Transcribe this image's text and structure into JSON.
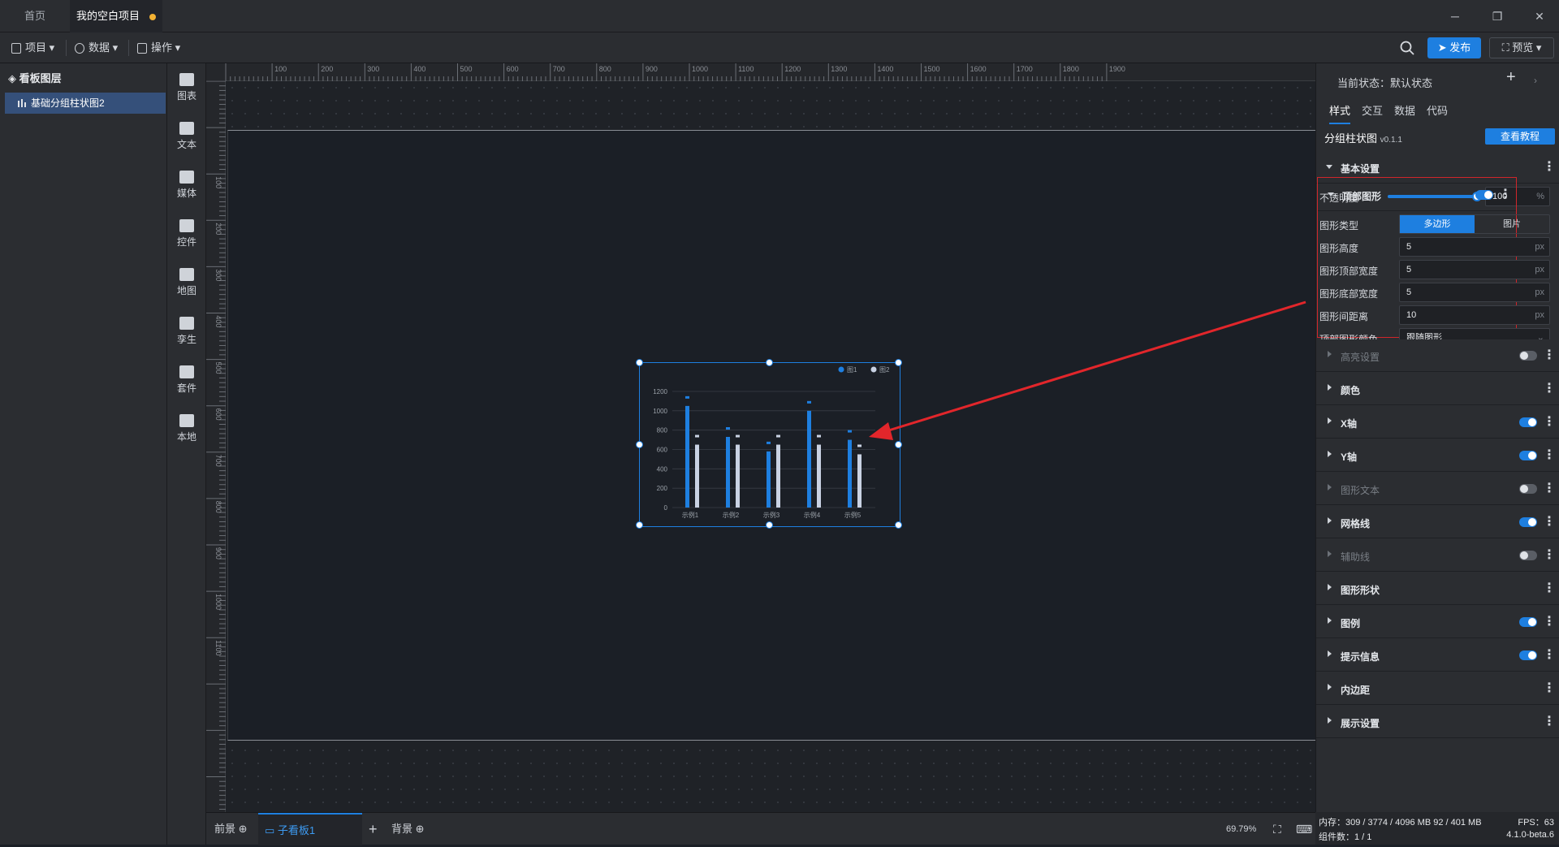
{
  "titlebar": {
    "tabs": [
      {
        "label": "首页"
      },
      {
        "label": "我的空白项目"
      }
    ],
    "win": {
      "minimize": "─",
      "restore": "❐",
      "close": "✕"
    }
  },
  "menubar": {
    "project": "项目",
    "data": "数据",
    "ops": "操作",
    "publish": "发布",
    "preview": "预览"
  },
  "layers": {
    "title": "看板图层",
    "items": [
      {
        "label": "基础分组柱状图2"
      }
    ]
  },
  "components": [
    {
      "label": "图表"
    },
    {
      "label": "文本"
    },
    {
      "label": "媒体"
    },
    {
      "label": "控件"
    },
    {
      "label": "地图"
    },
    {
      "label": "孪生"
    },
    {
      "label": "套件"
    },
    {
      "label": "本地"
    }
  ],
  "ruler": {
    "top": [
      "100",
      "200",
      "300",
      "400",
      "500",
      "600",
      "700",
      "800",
      "900",
      "1000",
      "1100",
      "1200",
      "1300",
      "1400",
      "1500",
      "1600",
      "1700",
      "1800",
      "1900"
    ],
    "left": [
      "100",
      "200",
      "300",
      "400",
      "500",
      "600",
      "700",
      "800",
      "900",
      "1000",
      "1100"
    ]
  },
  "chart_data": {
    "type": "bar",
    "categories": [
      "示例1",
      "示例2",
      "示例3",
      "示例4",
      "示例5"
    ],
    "series": [
      {
        "name": "图1",
        "values": [
          1050,
          730,
          580,
          1000,
          700
        ]
      },
      {
        "name": "图2",
        "values": [
          650,
          650,
          650,
          650,
          550
        ]
      }
    ],
    "yticks": [
      "0",
      "200",
      "400",
      "600",
      "800",
      "1000",
      "1200"
    ],
    "ylim": [
      0,
      1200
    ],
    "legend": "top-right",
    "grid": true,
    "colors": [
      "#1e7fe0",
      "#c9d2e3"
    ]
  },
  "bottom": {
    "front": "前景",
    "board": "子看板1",
    "back": "背景",
    "zoom": "69.79%"
  },
  "panel": {
    "state_label": "当前状态：默认状态",
    "tabs": [
      "样式",
      "交互",
      "数据",
      "代码"
    ],
    "comp_name": "分组柱状图",
    "version": "v0.1.1",
    "tutorial": "查看教程",
    "basic": "基本设置",
    "opacity_label": "不透明度",
    "opacity_value": "100",
    "opacity_unit": "%",
    "opacity": 1.0,
    "top_shape": {
      "title": "顶部图形",
      "type_label": "图形类型",
      "type_opts": [
        "多边形",
        "图片"
      ],
      "height_label": "图形高度",
      "height": "5",
      "topw_label": "图形顶部宽度",
      "topw": "5",
      "botw_label": "图形底部宽度",
      "botw": "5",
      "gap_label": "图形间距离",
      "gap": "10",
      "color_label": "顶部图形颜色",
      "color": "跟随图形",
      "unit": "px"
    },
    "sections": [
      {
        "label": "高亮设置",
        "toggle": "off",
        "dim": true
      },
      {
        "label": "颜色"
      },
      {
        "label": "X轴",
        "toggle": "on"
      },
      {
        "label": "Y轴",
        "toggle": "on"
      },
      {
        "label": "图形文本",
        "toggle": "off",
        "dim": true
      },
      {
        "label": "网格线",
        "toggle": "on"
      },
      {
        "label": "辅助线",
        "toggle": "off",
        "dim": true
      },
      {
        "label": "图形形状"
      },
      {
        "label": "图例",
        "toggle": "on"
      },
      {
        "label": "提示信息",
        "toggle": "on"
      },
      {
        "label": "内边距"
      },
      {
        "label": "展示设置"
      }
    ]
  },
  "status": {
    "mem": "内存：309 / 3774 / 4096 MB  92 / 401 MB",
    "fps": "FPS：63",
    "count": "组件数：1 / 1",
    "ver": "4.1.0-beta.6"
  }
}
